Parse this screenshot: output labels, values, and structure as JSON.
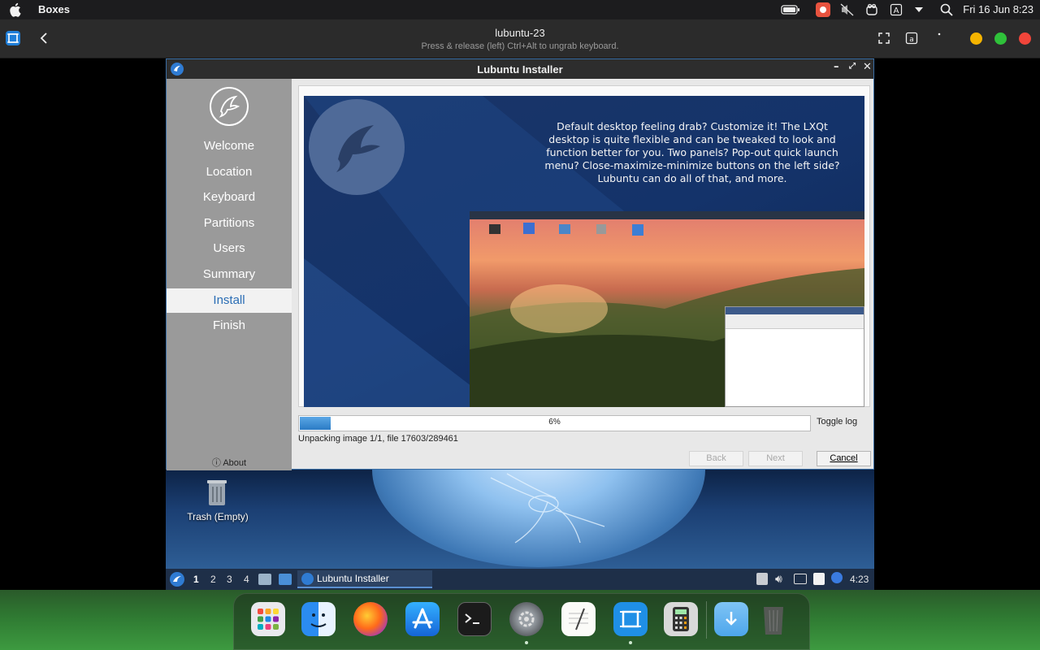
{
  "menubar": {
    "app_name": "Boxes",
    "clock": "Fri 16 Jun 8:23"
  },
  "boxes": {
    "title": "lubuntu-23",
    "subtitle": "Press & release (left) Ctrl+Alt to ungrab keyboard."
  },
  "installer": {
    "title": "Lubuntu Installer",
    "steps": [
      "Welcome",
      "Location",
      "Keyboard",
      "Partitions",
      "Users",
      "Summary",
      "Install",
      "Finish"
    ],
    "active_step": "Install",
    "about": "About",
    "slide_text": "Default desktop feeling drab? Customize it! The LXQt desktop is quite flexible and can be tweaked to look and function better for you. Two panels? Pop-out quick launch menu? Close-maximize-minimize buttons on the left side? Lubuntu can do all of that, and more.",
    "progress_percent": 6,
    "progress_label": "6%",
    "toggle_log": "Toggle log",
    "status": "Unpacking image 1/1, file 17603/289461",
    "back": "Back",
    "next": "Next",
    "cancel": "Cancel"
  },
  "vm_desktop": {
    "trash_label": "Trash (Empty)"
  },
  "lxqt_panel": {
    "workspaces": [
      "1",
      "2",
      "3",
      "4"
    ],
    "active_workspace": "1",
    "task": "Lubuntu Installer",
    "clock": "4:23"
  },
  "dock": {
    "apps": [
      "launchpad-icon",
      "finder-icon",
      "firefox-icon",
      "app-store-icon",
      "terminal-icon",
      "system-preferences-icon",
      "textedit-icon",
      "boxes-icon",
      "calculator-icon",
      "downloads-folder-icon",
      "trash-icon"
    ]
  },
  "colors": {
    "accent": "#2a6db5",
    "traffic_yellow": "#f5b400",
    "traffic_green": "#2fc13a",
    "traffic_red": "#f0453a"
  }
}
